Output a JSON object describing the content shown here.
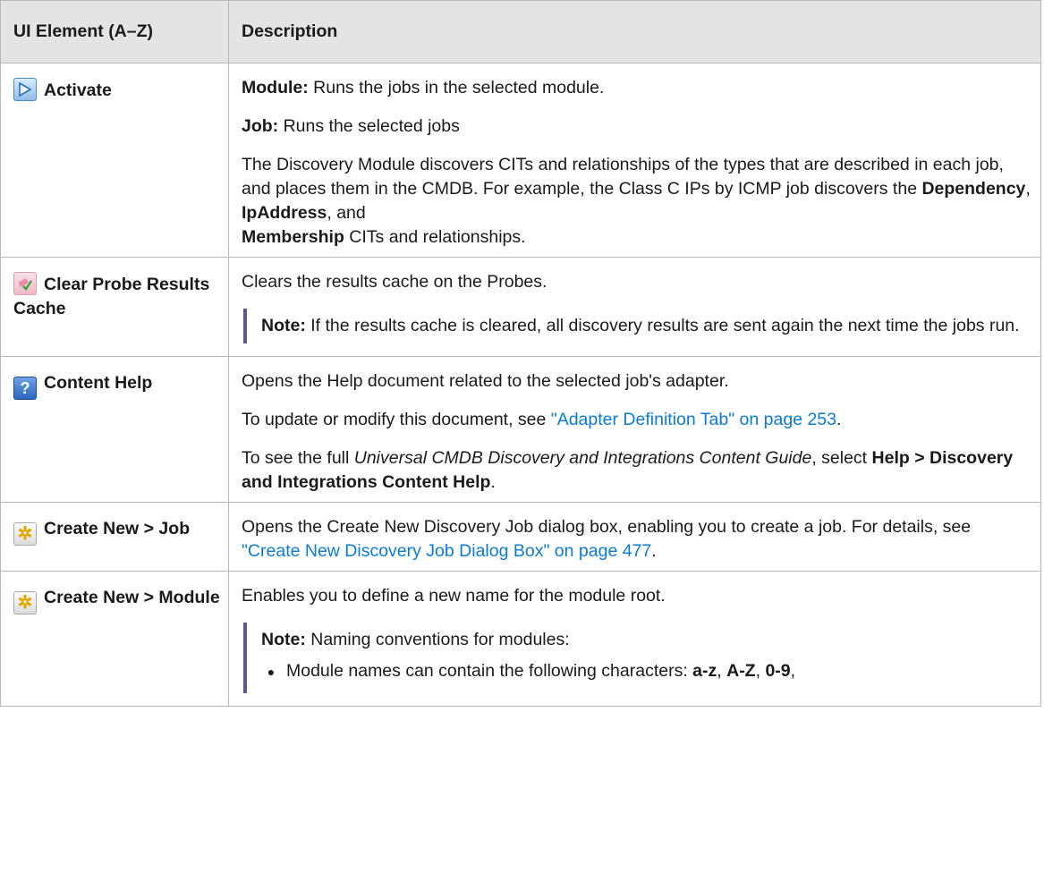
{
  "header": {
    "col1": "UI Element (A–Z)",
    "col2": "Description"
  },
  "rows": [
    {
      "element": "Activate",
      "icon": "activate-icon",
      "module_label": "Module:",
      "module_text": " Runs the jobs in the selected module.",
      "job_label": "Job:",
      "job_text": " Runs the selected jobs",
      "para_a": "The Discovery Module discovers CITs and relationships of the types that are described in each job, and places them in the CMDB. For example, the Class C IPs by ICMP job discovers the ",
      "term1": "Dependency",
      "sep1": ", ",
      "term2": "IpAddress",
      "sep2": ", and ",
      "term3": "Membership",
      "para_end": " CITs and relationships."
    },
    {
      "element": "Clear Probe Results Cache",
      "icon": "clear-cache-icon",
      "text": "Clears the results cache on the Probes.",
      "note_label": "Note:",
      "note_text": "  If the results cache is cleared, all discovery results are sent again the next time the jobs run."
    },
    {
      "element": "Content Help",
      "icon": "help-icon",
      "text1": "Opens the Help document related to the selected job's adapter.",
      "text2_pre": "To update or modify this document, see ",
      "link1": "\"Adapter Definition Tab\" on page 253",
      "text2_post": ".",
      "text3_pre": "To see the full ",
      "guide": "Universal CMDB Discovery and Integrations Content Guide",
      "text3_mid": ", select ",
      "menu": "Help > Discovery and Integrations Content Help",
      "text3_post": "."
    },
    {
      "element": "Create New > Job",
      "icon": "new-icon",
      "text_pre": "Opens the Create New Discovery Job dialog box, enabling you to create a job. For details, see ",
      "link": "\"Create New Discovery Job Dialog Box\" on page 477",
      "text_post": "."
    },
    {
      "element": "Create New > Module",
      "icon": "new-icon",
      "text": "Enables you to define a new name for the module root.",
      "note_label": "Note:",
      "note_text": "  Naming conventions for modules:",
      "bullet_pre": "Module names can contain the following characters: ",
      "c1": "a-z",
      "s1": ", ",
      "c2": "A-Z",
      "s2": ", ",
      "c3": "0-9",
      "s3": ","
    }
  ]
}
